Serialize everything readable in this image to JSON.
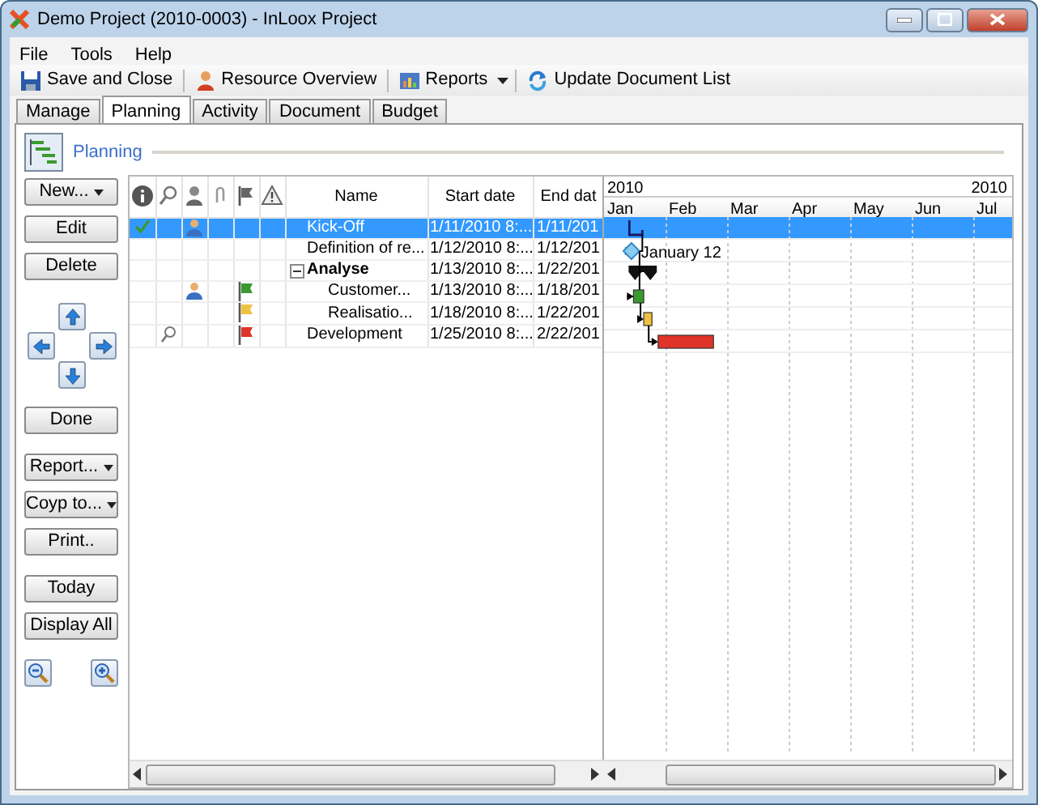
{
  "window": {
    "title": "Demo Project (2010-0003) - InLoox Project"
  },
  "menu": [
    "File",
    "Tools",
    "Help"
  ],
  "toolbar": [
    {
      "label": "Save and Close",
      "dropdown": false
    },
    {
      "label": "Resource Overview",
      "dropdown": false
    },
    {
      "label": "Reports",
      "dropdown": true
    },
    {
      "label": "Update Document List",
      "dropdown": false
    }
  ],
  "tabs": [
    {
      "label": "Manage",
      "selected": false
    },
    {
      "label": "Planning",
      "selected": true
    },
    {
      "label": "Activity",
      "selected": false
    },
    {
      "label": "Document",
      "selected": false
    },
    {
      "label": "Budget",
      "selected": false
    }
  ],
  "section": {
    "title": "Planning"
  },
  "side_buttons": [
    {
      "kind": "button",
      "label": "New...",
      "dropdown": true
    },
    {
      "kind": "button",
      "label": "Edit",
      "dropdown": false
    },
    {
      "kind": "button",
      "label": "Delete",
      "dropdown": false
    },
    {
      "kind": "arrows"
    },
    {
      "kind": "button",
      "label": "Done",
      "dropdown": false
    },
    {
      "kind": "button",
      "label": "Report...",
      "dropdown": true
    },
    {
      "kind": "button",
      "label": "Coyp to...",
      "dropdown": true
    },
    {
      "kind": "button",
      "label": "Print..",
      "dropdown": false
    },
    {
      "kind": "button",
      "label": "Today",
      "dropdown": false
    },
    {
      "kind": "button",
      "label": "Display All",
      "dropdown": false
    },
    {
      "kind": "zoom"
    }
  ],
  "table": {
    "columns": [
      "Name",
      "Start date",
      "End dat"
    ],
    "rows": [
      {
        "name": "Kick-Off",
        "start": "1/11/2010 8:...",
        "end": "1/11/201",
        "selected": true,
        "done": true,
        "resource": true,
        "note": false,
        "summary": false,
        "bar": {
          "kind": "flag",
          "linked": false
        }
      },
      {
        "name": "Definition of re...",
        "start": "1/12/2010 8:...",
        "end": "1/12/201",
        "selected": false,
        "done": false,
        "resource": false,
        "note": false,
        "summary": false,
        "bar": {
          "kind": "milestone",
          "label": "January 12",
          "linked": true
        }
      },
      {
        "name": "Analyse",
        "start": "1/13/2010 8:...",
        "end": "1/22/201",
        "selected": false,
        "done": false,
        "resource": false,
        "note": false,
        "summary": true,
        "expanded": true,
        "bar": {
          "kind": "summary",
          "linked": false
        },
        "children": [
          {
            "name": "Customer...",
            "start": "1/13/2010 8:...",
            "end": "1/18/201",
            "selected": false,
            "done": false,
            "resource": true,
            "note": false,
            "summary": false,
            "color": "#3a9a30",
            "bar": {
              "kind": "task",
              "linked": true
            }
          },
          {
            "name": "Realisatio...",
            "start": "1/18/2010 8:...",
            "end": "1/22/201",
            "selected": false,
            "done": false,
            "resource": false,
            "note": false,
            "summary": false,
            "color": "#f0c040",
            "bar": {
              "kind": "task",
              "linked": true
            }
          }
        ]
      },
      {
        "name": "Development",
        "start": "1/25/2010 8:...",
        "end": "2/22/201",
        "selected": false,
        "done": false,
        "resource": false,
        "note": true,
        "summary": false,
        "color": "#e03428",
        "bar": {
          "kind": "task",
          "linked": true
        }
      }
    ]
  },
  "gantt": {
    "years": [
      "2010",
      "2010"
    ],
    "months": [
      "Jan",
      "Feb",
      "Mar",
      "Apr",
      "May",
      "Jun",
      "Jul"
    ]
  }
}
